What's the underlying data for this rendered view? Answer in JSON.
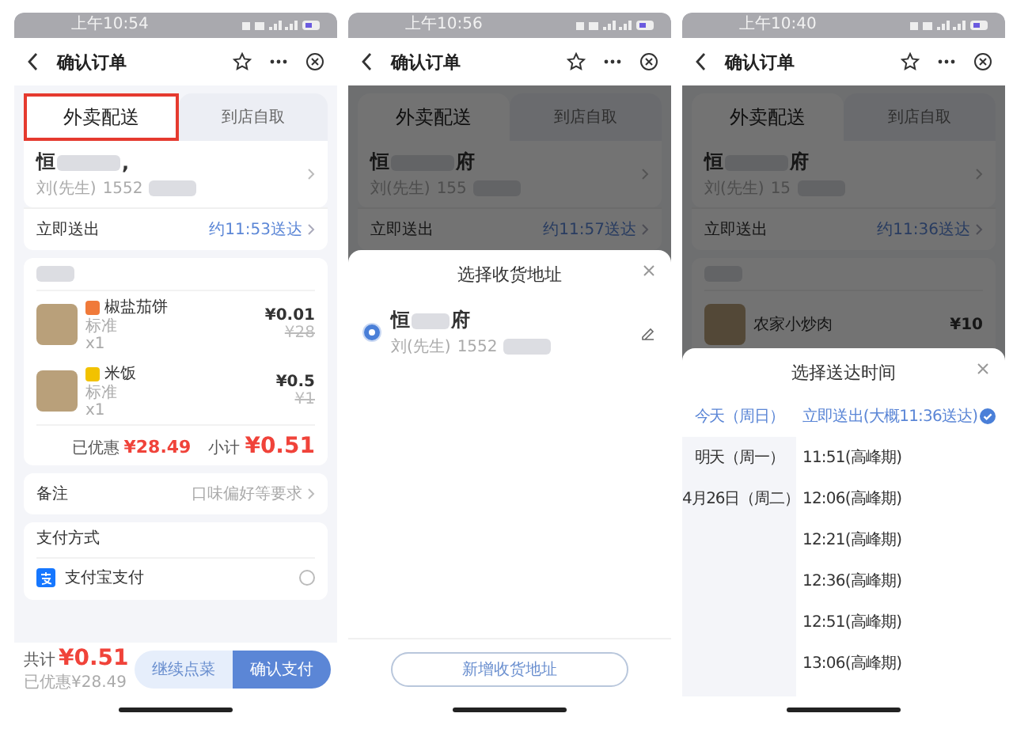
{
  "screens": [
    {
      "kind": "order",
      "status_time": "上午10:54",
      "title": "确认订单",
      "tabs": [
        {
          "label": "外卖配送",
          "selected": true,
          "highlighted": true
        },
        {
          "label": "到店自取",
          "selected": false,
          "highlighted": false
        }
      ],
      "address": {
        "name_start": "恒",
        "name_end": ",",
        "contact": "刘(先生)",
        "phone": "1552"
      },
      "delivery": {
        "label": "立即送出",
        "eta": "约11:53送达"
      },
      "items": [
        {
          "name": "椒盐茄饼",
          "color": "#f07a3a",
          "spec": "标准",
          "qty": "x1",
          "price": "¥0.01",
          "original_price": "¥28"
        },
        {
          "name": "米饭",
          "color": "#f2c200",
          "spec": "标准",
          "qty": "x1",
          "price": "¥0.5",
          "original_price": "¥1"
        }
      ],
      "summary": {
        "discount_label": "已优惠",
        "discount": "¥28.49",
        "subtotal_label": "小计",
        "subtotal": "¥0.51"
      },
      "remark": {
        "label": "备注",
        "placeholder": "口味偏好等要求"
      },
      "payment": {
        "title": "支付方式",
        "method": "支付宝支付",
        "selected": false
      },
      "footer": {
        "total_label": "共计",
        "total": "¥0.51",
        "saved": "已优惠¥28.49",
        "continue": "继续点菜",
        "confirm": "确认支付"
      }
    },
    {
      "kind": "address_sheet",
      "status_time": "上午10:56",
      "title": "确认订单",
      "tabs": [
        {
          "label": "外卖配送",
          "selected": true,
          "highlighted": false
        },
        {
          "label": "到店自取",
          "selected": false,
          "highlighted": false
        }
      ],
      "address": {
        "name_start": "恒",
        "name_end": "府",
        "contact": "刘(先生)",
        "phone": "155"
      },
      "delivery": {
        "label": "立即送出",
        "eta": "约11:57送达"
      },
      "sheet": {
        "title": "选择收货地址",
        "addresses": [
          {
            "name_start": "恒",
            "name_end": "府",
            "contact": "刘(先生)",
            "phone": "1552",
            "selected": true
          }
        ],
        "add_button": "新增收货地址"
      }
    },
    {
      "kind": "time_sheet",
      "status_time": "上午10:40",
      "title": "确认订单",
      "tabs": [
        {
          "label": "外卖配送",
          "selected": true,
          "highlighted": false
        },
        {
          "label": "到店自取",
          "selected": false,
          "highlighted": false
        }
      ],
      "address": {
        "name_start": "恒",
        "name_end": "府",
        "contact": "刘(先生)",
        "phone": "15"
      },
      "delivery": {
        "label": "立即送出",
        "eta": "约11:36送达"
      },
      "items": [
        {
          "name": "农家小炒肉",
          "price": "¥10"
        }
      ],
      "sheet": {
        "title": "选择送达时间",
        "days": [
          {
            "label": "今天（周日）",
            "selected": true
          },
          {
            "label": "明天（周一）",
            "selected": false
          },
          {
            "label": "4月26日（周二）",
            "selected": false
          }
        ],
        "slots": [
          {
            "label": "立即送出(大概11:36送达)",
            "selected": true
          },
          {
            "label": "11:51(高峰期)",
            "selected": false
          },
          {
            "label": "12:06(高峰期)",
            "selected": false
          },
          {
            "label": "12:21(高峰期)",
            "selected": false
          },
          {
            "label": "12:36(高峰期)",
            "selected": false
          },
          {
            "label": "12:51(高峰期)",
            "selected": false
          },
          {
            "label": "13:06(高峰期)",
            "selected": false
          }
        ]
      }
    }
  ]
}
